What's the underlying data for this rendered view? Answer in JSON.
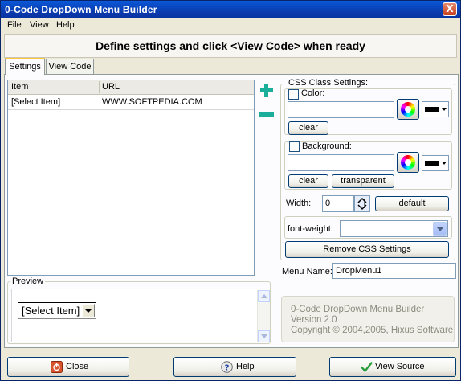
{
  "window": {
    "title": "0-Code DropDown Menu Builder",
    "close_glyph": "X"
  },
  "menubar": [
    "File",
    "View",
    "Help"
  ],
  "banner": "Define settings and click <View Code> when ready",
  "tabs": [
    {
      "label": "Settings",
      "active": true
    },
    {
      "label": "View Code",
      "active": false
    }
  ],
  "items_list": {
    "columns": [
      "Item",
      "URL"
    ],
    "rows": [
      {
        "item": "[Select Item]",
        "url": "WWW.SOFTPEDIA.COM"
      }
    ]
  },
  "css": {
    "group_label": "CSS Class Settings:",
    "color": {
      "label": "Color:",
      "checked": false,
      "value": "",
      "swatch": "#000000",
      "clear_label": "clear"
    },
    "background": {
      "label": "Background:",
      "checked": false,
      "value": "",
      "swatch": "#000000",
      "clear_label": "clear",
      "transparent_label": "transparent"
    },
    "width": {
      "label": "Width:",
      "value": "0",
      "default_label": "default"
    },
    "font_weight": {
      "label": "font-weight:",
      "value": ""
    },
    "remove_label": "Remove CSS Settings"
  },
  "menu_name": {
    "label": "Menu Name:",
    "value": "DropMenu1"
  },
  "preview": {
    "label": "Preview",
    "select_value": "[Select Item]"
  },
  "about": {
    "line1": "0-Code DropDown Menu Builder",
    "line2": "Version 2.0",
    "line3": "Copyright © 2004,2005, Hixus Software"
  },
  "buttons": {
    "close": "Close",
    "help": "Help",
    "view_source": "View Source"
  },
  "colors": {
    "titlebar": "#0A3CB0",
    "accent": "#1BAE9B",
    "face": "#ECE9D8"
  },
  "icons": [
    "plus-icon",
    "minus-icon",
    "color-wheel-icon",
    "spin-arrows-icon",
    "power-icon",
    "help-icon",
    "checkmark-icon"
  ]
}
